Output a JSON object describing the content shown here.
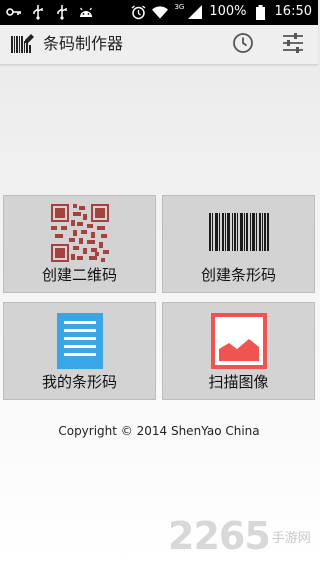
{
  "status_bar": {
    "network": "3G",
    "battery": "100%",
    "time": "16:50",
    "left_icons": [
      "key-icon",
      "usb-icon",
      "usb-icon",
      "android-icon"
    ],
    "right_icons": [
      "alarm-icon",
      "wifi-icon",
      "signal-icon",
      "battery-icon"
    ]
  },
  "app_bar": {
    "title": "条码制作器",
    "actions": [
      "history-icon",
      "settings-sliders-icon"
    ]
  },
  "tiles": [
    {
      "label": "创建二维码",
      "icon": "qr-code-icon",
      "color": "#a6423d"
    },
    {
      "label": "创建条形码",
      "icon": "barcode-icon",
      "color": "#1a1a1a"
    },
    {
      "label": "我的条形码",
      "icon": "document-list-icon",
      "color": "#3aa6e6"
    },
    {
      "label": "扫描图像",
      "icon": "image-icon",
      "color": "#f05450"
    }
  ],
  "footer": {
    "copyright": "Copyright © 2014 ShenYao China"
  },
  "watermark": {
    "number": "2265",
    "site": "手游网"
  }
}
